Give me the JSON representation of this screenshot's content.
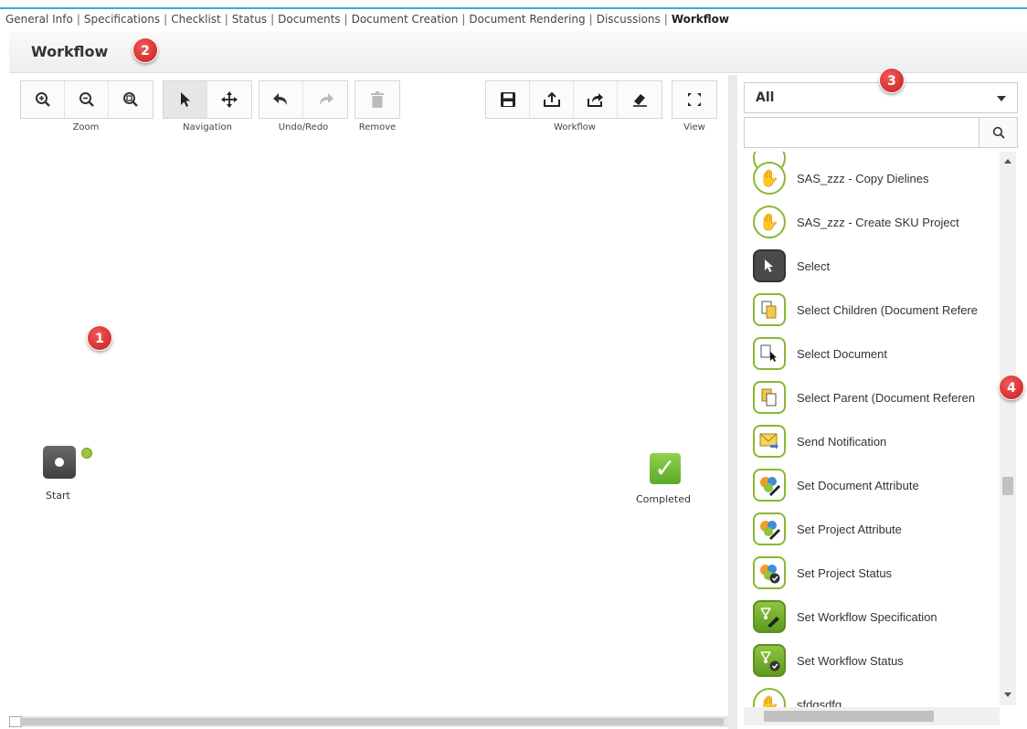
{
  "tabs": [
    {
      "label": "General Info"
    },
    {
      "label": "Specifications"
    },
    {
      "label": "Checklist"
    },
    {
      "label": "Status"
    },
    {
      "label": "Documents"
    },
    {
      "label": "Document Creation"
    },
    {
      "label": "Document Rendering"
    },
    {
      "label": "Discussions"
    },
    {
      "label": "Workflow",
      "active": true
    }
  ],
  "header": {
    "title": "Workflow"
  },
  "badges": [
    "1",
    "2",
    "3",
    "4"
  ],
  "toolbar": {
    "zoom_label": "Zoom",
    "navigation_label": "Navigation",
    "undo_redo_label": "Undo/Redo",
    "remove_label": "Remove",
    "workflow_label": "Workflow",
    "view_label": "View"
  },
  "canvas": {
    "start_label": "Start",
    "completed_label": "Completed"
  },
  "side": {
    "filter_value": "All",
    "search_placeholder": "",
    "items": [
      {
        "label": "SAS_zzz - Copy Dielines",
        "icon": "hand-icon"
      },
      {
        "label": "SAS_zzz - Create SKU Project",
        "icon": "hand-icon"
      },
      {
        "label": "Select",
        "icon": "cursor-icon"
      },
      {
        "label": "Select Children (Document Refere",
        "icon": "documents-icon"
      },
      {
        "label": "Select Document",
        "icon": "document-cursor-icon"
      },
      {
        "label": "Select Parent (Document Referen",
        "icon": "documents-icon"
      },
      {
        "label": "Send Notification",
        "icon": "envelope-icon"
      },
      {
        "label": "Set Document Attribute",
        "icon": "attribute-edit-icon"
      },
      {
        "label": "Set Project Attribute",
        "icon": "attribute-edit-icon"
      },
      {
        "label": "Set Project Status",
        "icon": "attribute-status-icon"
      },
      {
        "label": "Set Workflow Specification",
        "icon": "workflow-edit-icon"
      },
      {
        "label": "Set Workflow Status",
        "icon": "workflow-status-icon"
      },
      {
        "label": "sfdgsdfg",
        "icon": "hand-icon"
      }
    ]
  },
  "colors": {
    "accent": "#3fa9d6",
    "badge": "#d62d2d",
    "green": "#8ab732"
  }
}
